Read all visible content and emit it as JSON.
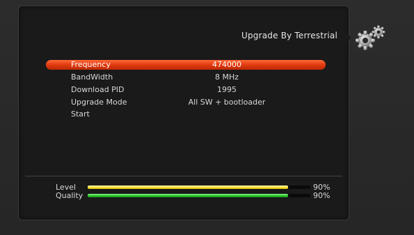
{
  "header": {
    "title": "Upgrade By Terrestrial",
    "icon": "settings-gears-icon"
  },
  "menu": {
    "items": [
      {
        "label": "Frequency",
        "value": "474000",
        "selected": true
      },
      {
        "label": "BandWidth",
        "value": "8 MHz",
        "selected": false
      },
      {
        "label": "Download PID",
        "value": "1995",
        "selected": false
      },
      {
        "label": "Upgrade Mode",
        "value": "All SW + bootloader",
        "selected": false
      },
      {
        "label": "Start",
        "value": "",
        "selected": false
      }
    ]
  },
  "signal": {
    "level": {
      "label": "Level",
      "percent": 90,
      "display": "90%",
      "color": "#ffe44a"
    },
    "quality": {
      "label": "Quality",
      "percent": 90,
      "display": "90%",
      "color": "#32c832"
    }
  },
  "colors": {
    "selection": "#e23a10",
    "panel": "#1a1a1a"
  }
}
